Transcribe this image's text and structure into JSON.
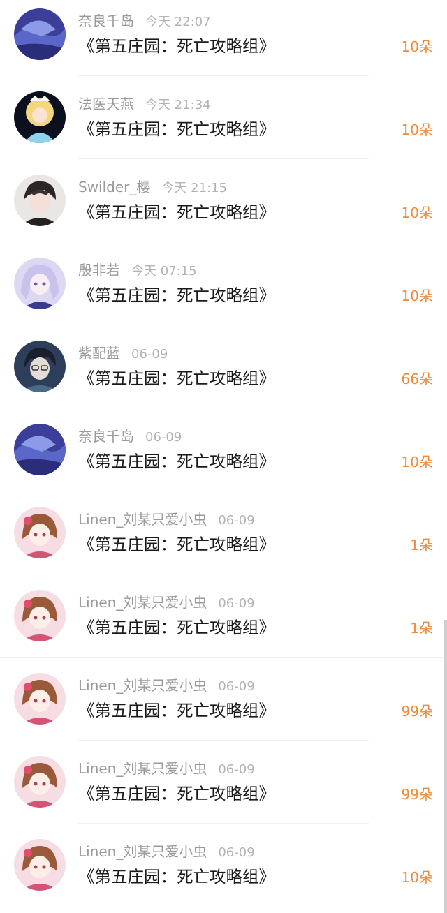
{
  "colors": {
    "username": "#9a9a9a",
    "time": "#b3b3b3",
    "title": "#1a1a1a",
    "amount": "#ef8a3a",
    "divider": "#f0f0f0"
  },
  "rows": [
    {
      "avatar": "avatar-blue-ocean",
      "username": "奈良千岛",
      "time": "今天 22:07",
      "title": "《第五庄园：死亡攻略组》",
      "amount": "10朵"
    },
    {
      "avatar": "avatar-blonde-crown",
      "username": "法医天燕",
      "time": "今天 21:34",
      "title": "《第五庄园：死亡攻略组》",
      "amount": "10朵"
    },
    {
      "avatar": "avatar-dark-hair-boy",
      "username": "Swilder_樱",
      "time": "今天 21:15",
      "title": "《第五庄园：死亡攻略组》",
      "amount": "10朵"
    },
    {
      "avatar": "avatar-lavender-hair",
      "username": "殷非若",
      "time": "今天 07:15",
      "title": "《第五庄园：死亡攻略组》",
      "amount": "10朵"
    },
    {
      "avatar": "avatar-glasses-man",
      "username": "紫配蓝",
      "time": "06-09",
      "title": "《第五庄园：死亡攻略组》",
      "amount": "66朵"
    },
    {
      "avatar": "avatar-blue-ocean",
      "username": "奈良千岛",
      "time": "06-09",
      "title": "《第五庄园：死亡攻略组》",
      "amount": "10朵"
    },
    {
      "avatar": "avatar-pink-kimono-girl",
      "username": "Linen_刘某只爱小虫",
      "time": "06-09",
      "title": "《第五庄园：死亡攻略组》",
      "amount": "1朵"
    },
    {
      "avatar": "avatar-pink-kimono-girl",
      "username": "Linen_刘某只爱小虫",
      "time": "06-09",
      "title": "《第五庄园：死亡攻略组》",
      "amount": "1朵"
    },
    {
      "avatar": "avatar-pink-kimono-girl",
      "username": "Linen_刘某只爱小虫",
      "time": "06-09",
      "title": "《第五庄园：死亡攻略组》",
      "amount": "99朵"
    },
    {
      "avatar": "avatar-pink-kimono-girl",
      "username": "Linen_刘某只爱小虫",
      "time": "06-09",
      "title": "《第五庄园：死亡攻略组》",
      "amount": "99朵"
    },
    {
      "avatar": "avatar-pink-kimono-girl",
      "username": "Linen_刘某只爱小虫",
      "time": "06-09",
      "title": "《第五庄园：死亡攻略组》",
      "amount": "10朵"
    }
  ]
}
